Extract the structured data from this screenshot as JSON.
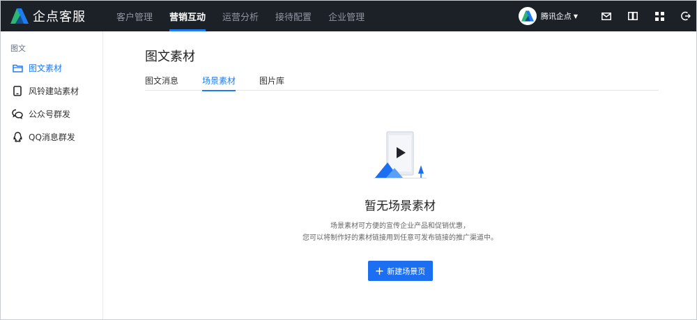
{
  "brand": {
    "name": "企点客服",
    "logo_icon": "qidian-logo-icon"
  },
  "nav": {
    "items": [
      {
        "label": "客户管理",
        "active": false
      },
      {
        "label": "营销互动",
        "active": true
      },
      {
        "label": "运营分析",
        "active": false
      },
      {
        "label": "接待配置",
        "active": false
      },
      {
        "label": "企业管理",
        "active": false
      }
    ]
  },
  "user": {
    "name": "腾讯企点",
    "avatar_icon": "qidian-avatar-icon"
  },
  "top_icons": [
    "mail-icon",
    "book-icon",
    "apps-grid-icon",
    "logout-icon"
  ],
  "sidebar": {
    "group_label": "图文",
    "items": [
      {
        "label": "图文素材",
        "icon": "folder-icon",
        "active": true
      },
      {
        "label": "风铃建站素材",
        "icon": "tablet-icon",
        "active": false
      },
      {
        "label": "公众号群发",
        "icon": "wechat-icon",
        "active": false
      },
      {
        "label": "QQ消息群发",
        "icon": "qq-icon",
        "active": false
      }
    ]
  },
  "main": {
    "title": "图文素材",
    "tabs": [
      {
        "label": "图文消息",
        "active": false
      },
      {
        "label": "场景素材",
        "active": true
      },
      {
        "label": "图片库",
        "active": false
      }
    ],
    "empty": {
      "title": "暂无场景素材",
      "desc_line1": "场景素材可方便的宣传企业产品和促销优惠，",
      "desc_line2": "您可以将制作好的素材链接用到任意可发布链接的推广渠道中。",
      "button_label": "新建场景页"
    }
  },
  "colors": {
    "accent": "#1d7cf2",
    "topbar": "#1c2128"
  }
}
